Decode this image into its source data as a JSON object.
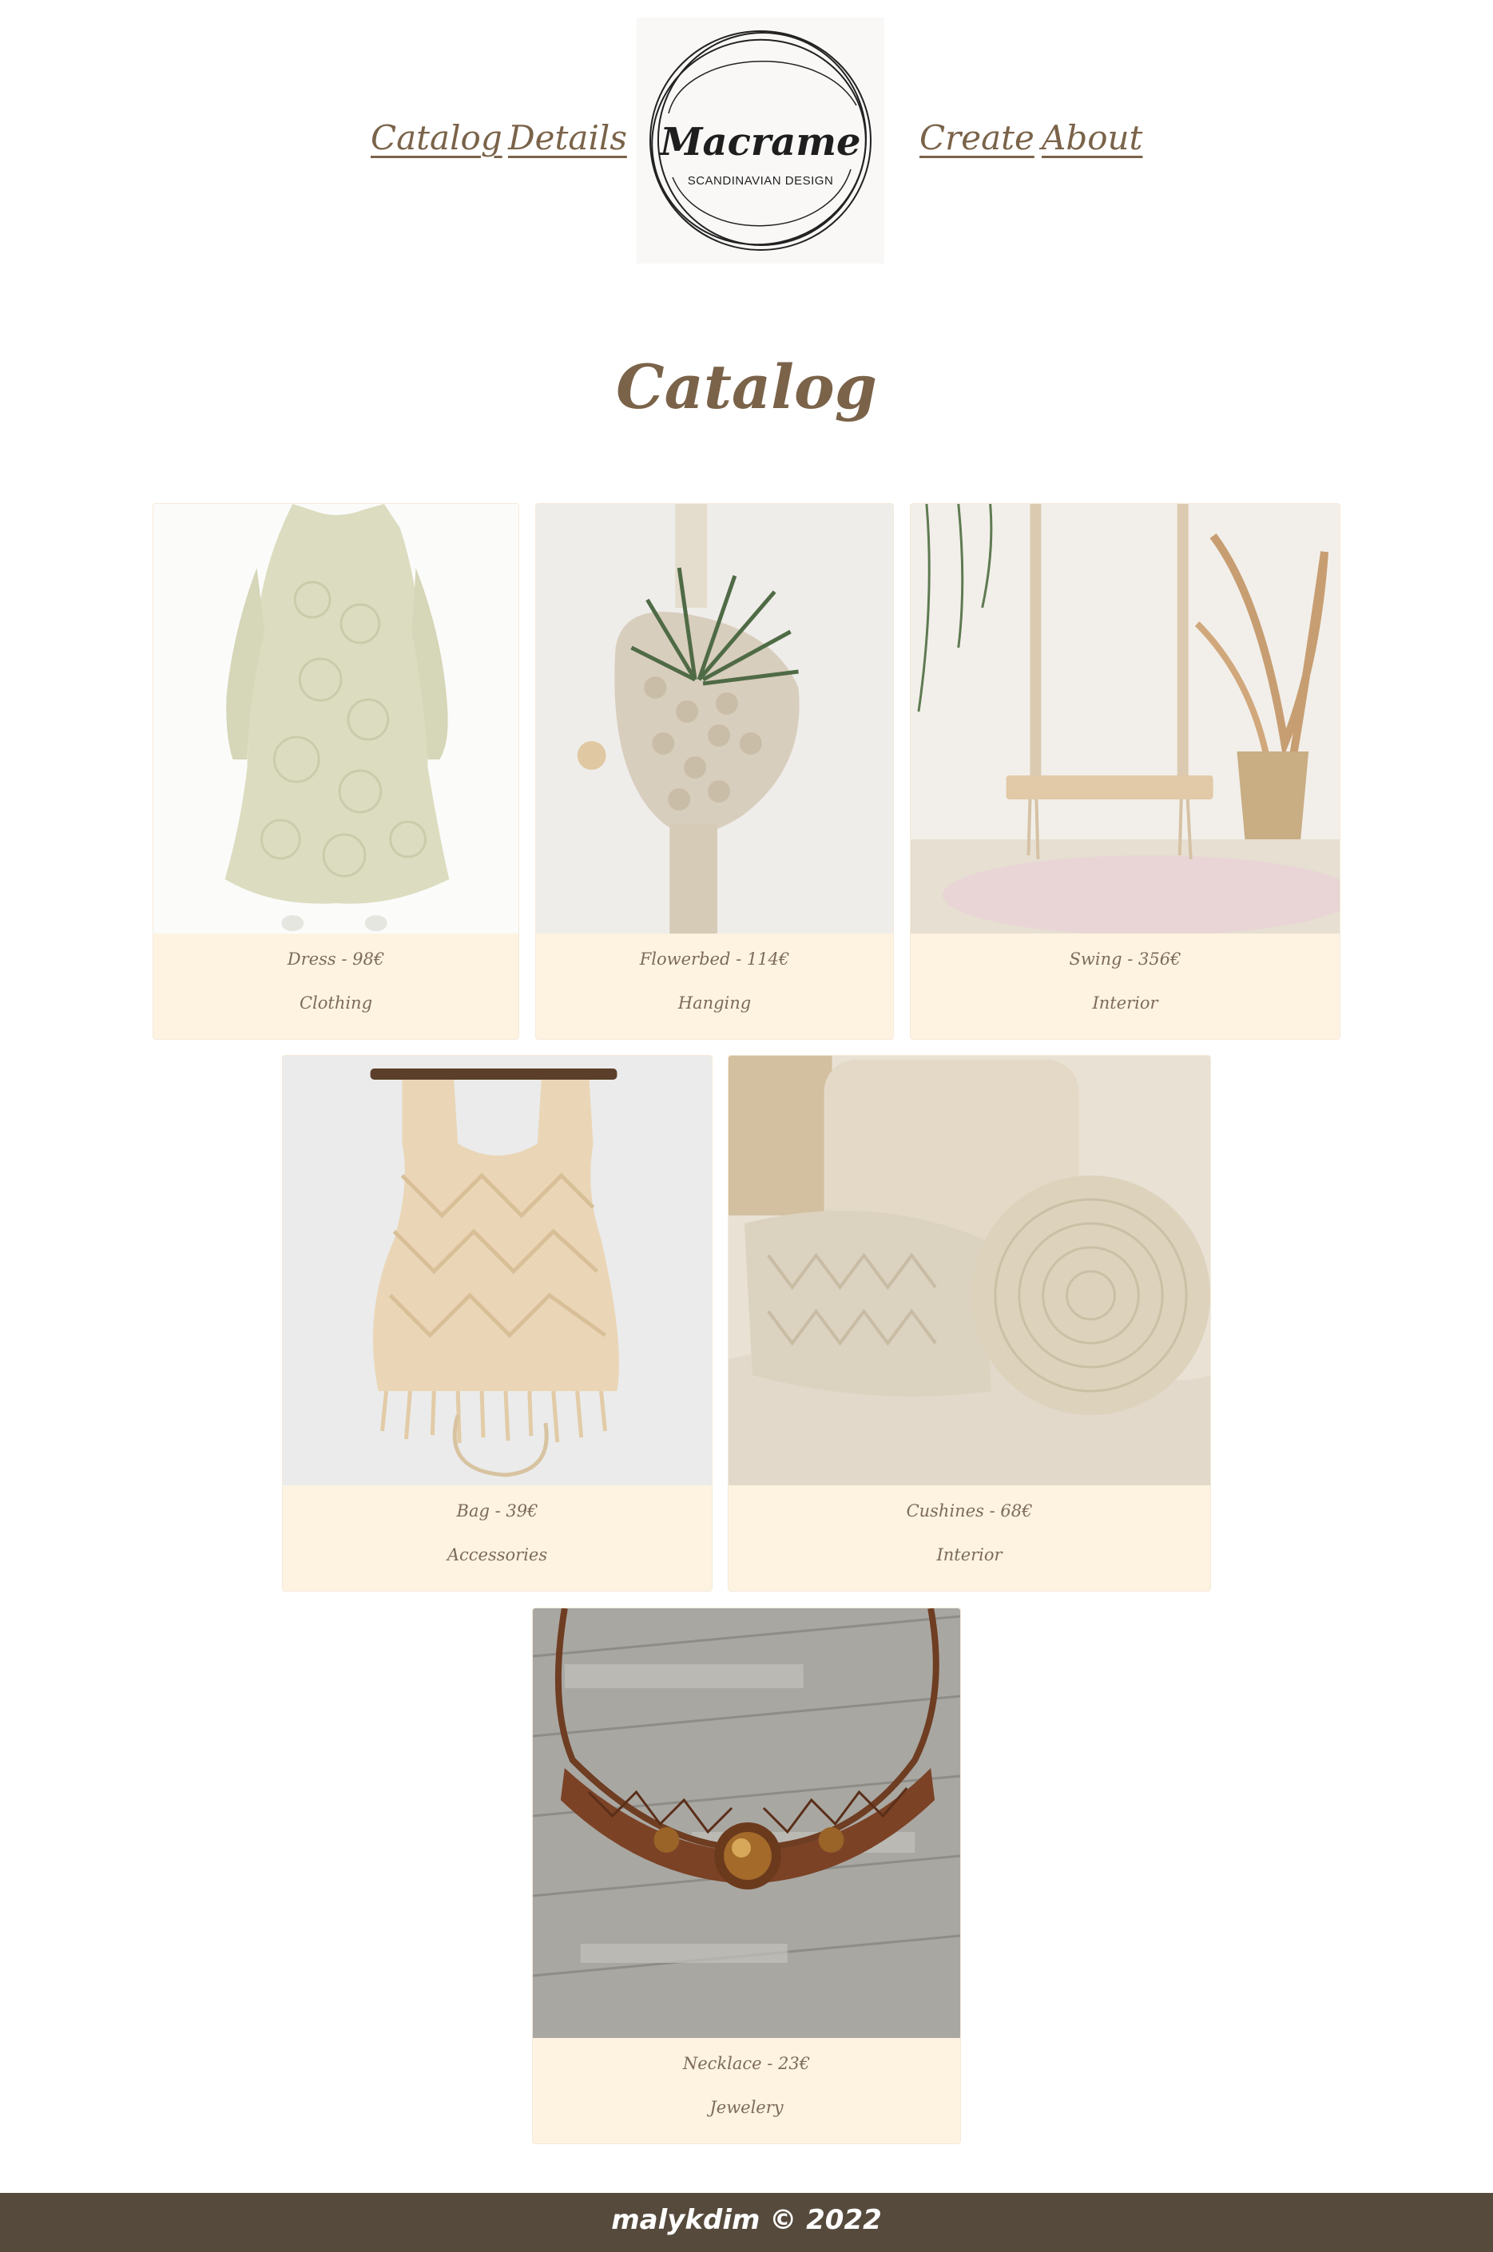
{
  "nav": {
    "left": [
      "Catalog",
      "Details"
    ],
    "right": [
      "Create",
      "About"
    ]
  },
  "logo": {
    "title": "Macrame",
    "subtitle": "SCANDINAVIAN DESIGN"
  },
  "page_title": "Catalog",
  "products": [
    {
      "name": "Dress - 98€",
      "category": "Clothing",
      "image": "cream-lace-dress-photo"
    },
    {
      "name": "Flowerbed - 114€",
      "category": "Hanging",
      "image": "macrame-plant-hanger-photo"
    },
    {
      "name": "Swing - 356€",
      "category": "Interior",
      "image": "rope-swing-pampas-photo"
    },
    {
      "name": "Bag - 39€",
      "category": "Accessories",
      "image": "macrame-bag-photo"
    },
    {
      "name": "Cushines - 68€",
      "category": "Interior",
      "image": "knitted-cushions-photo"
    },
    {
      "name": "Necklace - 23€",
      "category": "Jewelery",
      "image": "brown-macrame-necklace-photo"
    }
  ],
  "footer": {
    "text": "malykdim © 2022"
  },
  "colors": {
    "accent": "#7a6349",
    "card_bg": "#fef3e1",
    "footer_bg": "#564a3c"
  }
}
